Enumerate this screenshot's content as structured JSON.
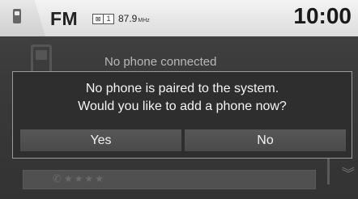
{
  "status_bar": {
    "band": "FM",
    "dl_icon_text": "⊠",
    "preset": "1",
    "frequency": "87.9",
    "frequency_unit": "MHz",
    "clock": "10:00"
  },
  "background": {
    "status_text": "No phone connected",
    "row_placeholder": "★★★★"
  },
  "dialog": {
    "line1": "No phone is paired to the system.",
    "line2": "Would you like to add a phone now?",
    "yes_label": "Yes",
    "no_label": "No"
  },
  "icons": {
    "phone_tab": "phone-icon",
    "scroll_down": "chevron-down-icon"
  }
}
